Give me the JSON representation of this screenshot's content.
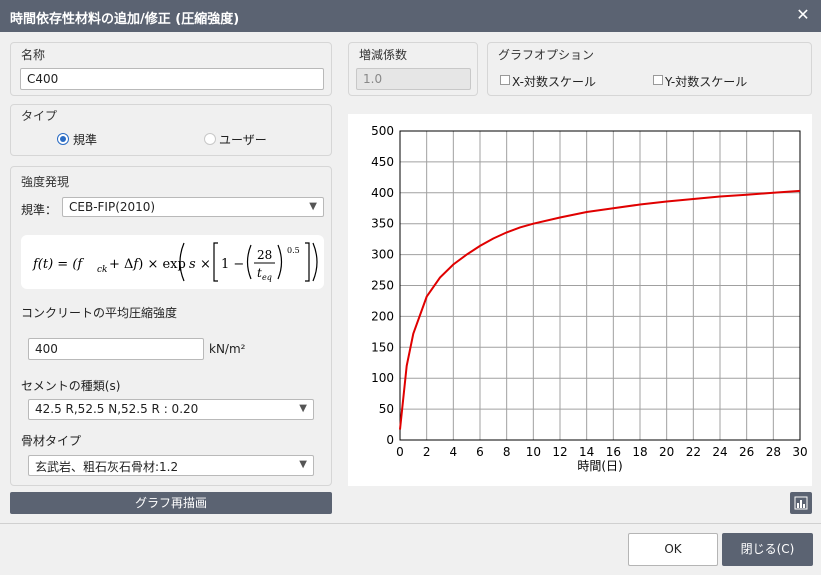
{
  "window": {
    "title": "時間依存性材料の追加/修正 (圧縮強度)"
  },
  "name_group": {
    "label": "名称",
    "value": "C400"
  },
  "factor_group": {
    "label": "増減係数",
    "value": "1.0"
  },
  "graph_options": {
    "label": "グラフオプション",
    "x_log": "X-対数スケール",
    "y_log": "Y-対数スケール"
  },
  "type_group": {
    "label": "タイプ",
    "option_standard": "規準",
    "option_user": "ユーザー"
  },
  "strength": {
    "label": "強度発現",
    "standard_label": "規準：",
    "standard_value": "CEB-FIP(2010)",
    "mean_strength_label": "コンクリートの平均圧縮強度",
    "mean_strength_value": "400",
    "unit": "kN/m²",
    "cement_label": "セメントの種類(s)",
    "cement_value": "42.5 R,52.5 N,52.5 R : 0.20",
    "aggregate_label": "骨材タイプ",
    "aggregate_value": "玄武岩、粗石灰石骨材:1.2"
  },
  "redraw_button": "グラフ再描画",
  "buttons": {
    "ok": "OK",
    "close": "閉じる(C)"
  },
  "chart_data": {
    "type": "line",
    "xlabel": "時間(日)",
    "ylabel": "",
    "xlim": [
      0,
      30
    ],
    "ylim": [
      0,
      500
    ],
    "x_ticks": [
      0,
      2,
      4,
      6,
      8,
      10,
      12,
      14,
      16,
      18,
      20,
      22,
      24,
      26,
      28,
      30
    ],
    "y_ticks": [
      0,
      50,
      100,
      150,
      200,
      250,
      300,
      350,
      400,
      450,
      500
    ],
    "grid": true,
    "series": [
      {
        "color": "#e00000",
        "x": [
          0,
          0.5,
          1,
          2,
          3,
          4,
          5,
          6,
          7,
          8,
          9,
          10,
          12,
          14,
          16,
          18,
          20,
          22,
          24,
          26,
          28,
          30
        ],
        "y": [
          17,
          120,
          172,
          232,
          263,
          284,
          300,
          314,
          326,
          336,
          344,
          350,
          360,
          369,
          375,
          381,
          386,
          390,
          394,
          397,
          400,
          403
        ]
      }
    ]
  }
}
